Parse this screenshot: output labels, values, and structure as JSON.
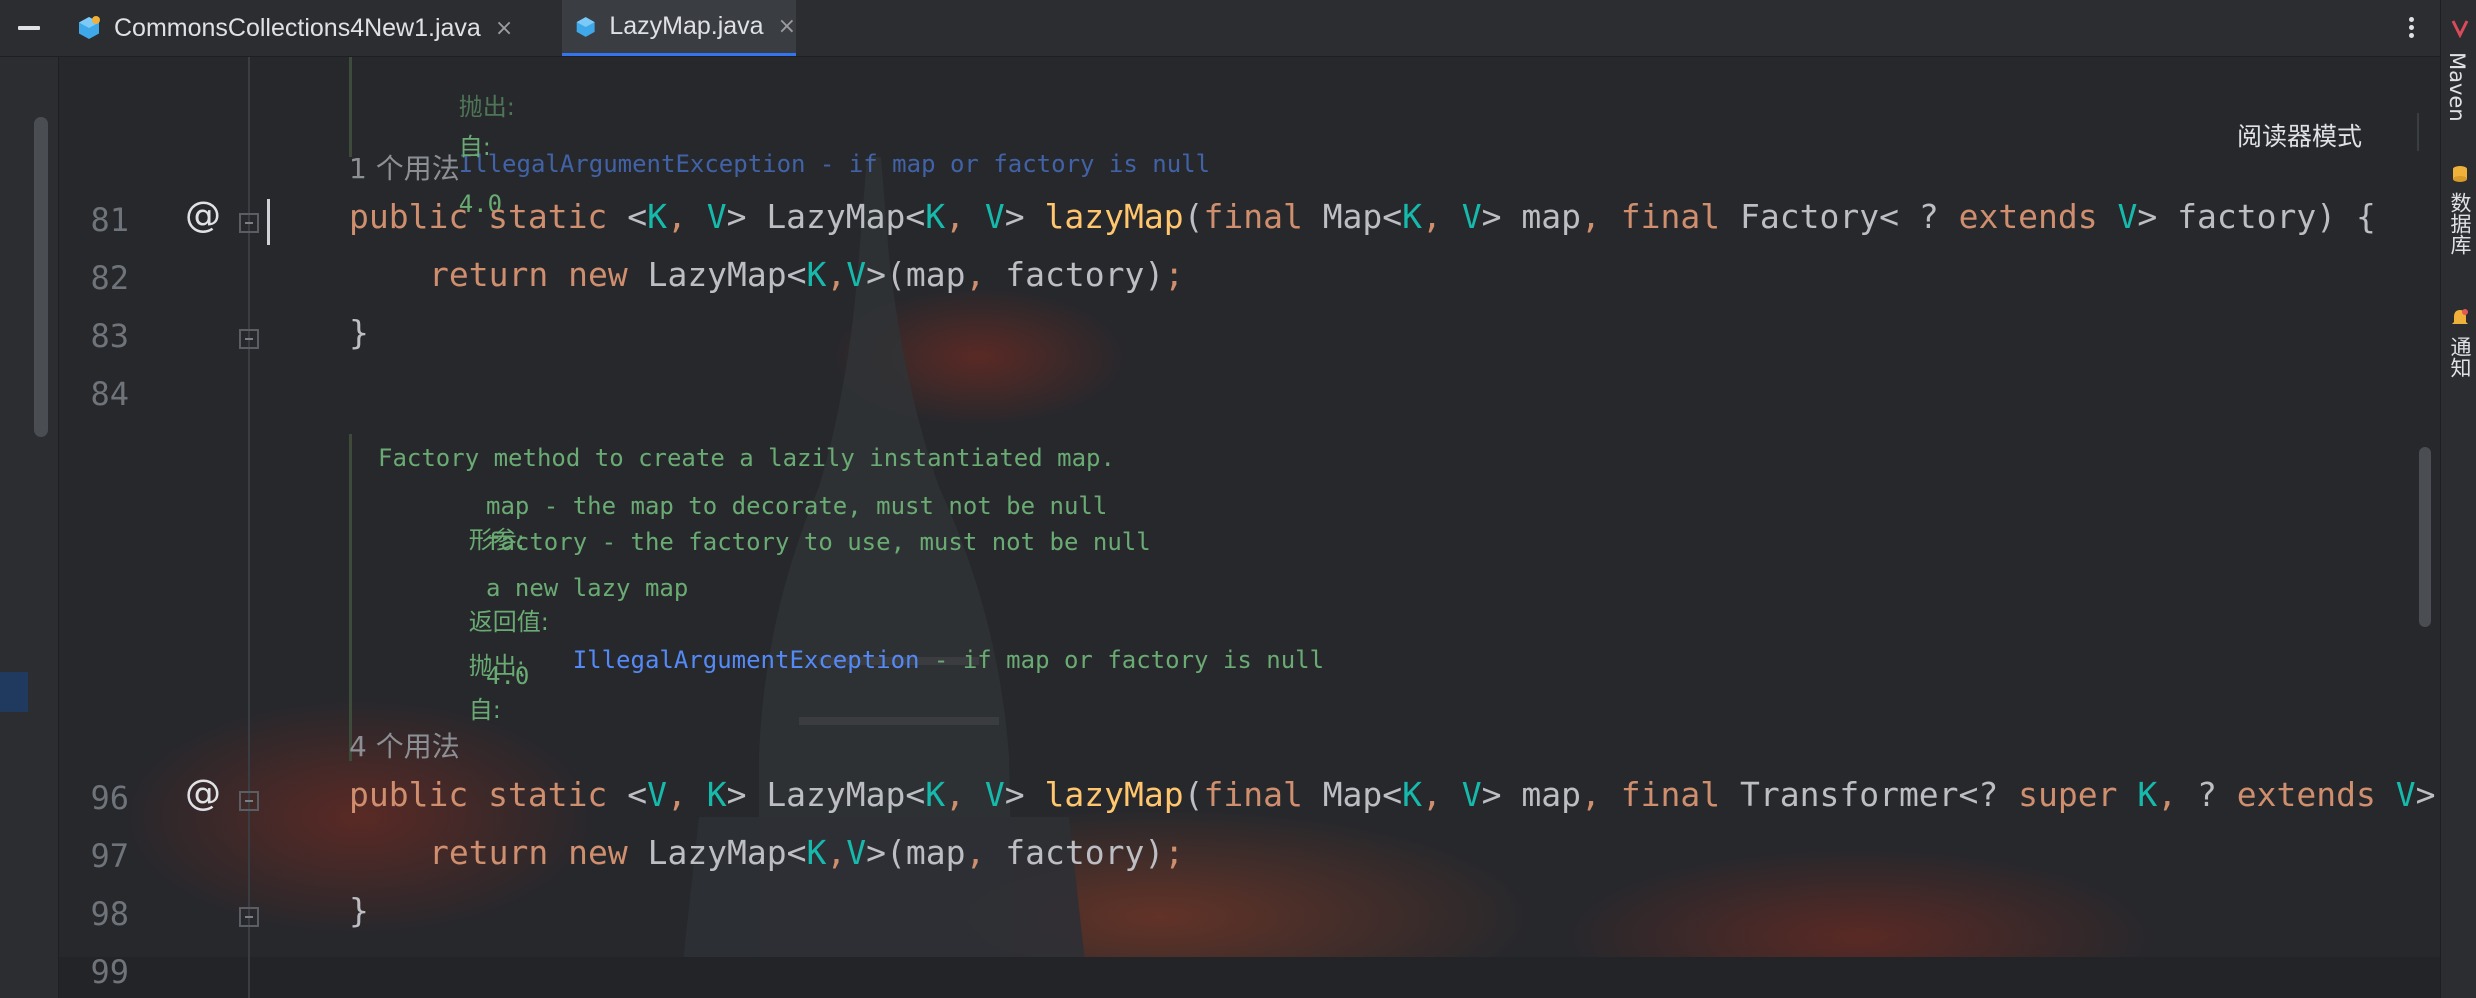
{
  "tabs": [
    {
      "label": "CommonsCollections4New1.java",
      "close": "×",
      "active": false
    },
    {
      "label": "LazyMap.java",
      "close": "×",
      "active": true
    }
  ],
  "reader_mode": "阅读器模式",
  "right_tools": [
    {
      "label": "Maven",
      "icon": "maven-icon"
    },
    {
      "label": "数据库",
      "icon": "database-icon"
    },
    {
      "label": "通知",
      "icon": "bell-icon"
    }
  ],
  "doc_top": {
    "throws_tag": "抛出:",
    "throws_text": "IllegalArgumentException - if map or factory is null",
    "since_tag": "自:",
    "since_value": "4.0"
  },
  "usage1": "1 个用法",
  "lines": [
    {
      "num": "81"
    },
    {
      "num": "82"
    },
    {
      "num": "83"
    },
    {
      "num": "84"
    },
    {
      "num": "96"
    },
    {
      "num": "97"
    },
    {
      "num": "98"
    },
    {
      "num": "99"
    }
  ],
  "at_symbol": "@",
  "code": {
    "l81": {
      "k1": "public",
      "k2": "static",
      "p1": "<",
      "t1": "K",
      "c1": ",",
      "t2": "V",
      "p2": ">",
      "ret": "LazyMap",
      "p3": "<",
      "t3": "K",
      "c2": ",",
      "t4": "V",
      "p4": ">",
      "fn": "lazyMap",
      "p5": "(",
      "k3": "final",
      "ty1": "Map",
      "p6": "<",
      "t5": "K",
      "c3": ",",
      "t6": "V",
      "p7": ">",
      "a1": "map",
      "c4": ",",
      "k4": "final",
      "ty2": "Factory",
      "p8": "<",
      "q": "?",
      "k5": "extends",
      "t7": "V",
      "p9": ">",
      "a2": "factory",
      "p10": ")",
      "brace": "{"
    },
    "l82": {
      "k1": "return",
      "k2": "new",
      "ty": "LazyMap",
      "p1": "<",
      "t1": "K",
      "c1": ",",
      "t2": "V",
      "p2": ">",
      "args": "(map",
      "c2": ",",
      "a2": "factory)",
      "semi": ";"
    },
    "l83": "}",
    "l96": {
      "k1": "public",
      "k2": "static",
      "p1": "<",
      "t1": "V",
      "c1": ",",
      "t2": "K",
      "p2": ">",
      "ret": "LazyMap",
      "p3": "<",
      "t3": "K",
      "c2": ",",
      "t4": "V",
      "p4": ">",
      "fn": "lazyMap",
      "p5": "(",
      "k3": "final",
      "ty1": "Map",
      "p6": "<",
      "t5": "K",
      "c3": ",",
      "t6": "V",
      "p7": ">",
      "a1": "map",
      "c4": ",",
      "k4": "final",
      "ty2": "Transformer",
      "p8": "<?",
      "k5": "super",
      "t7": "K",
      "c5": ",",
      "q": "?",
      "k6": "extends",
      "t8": "V",
      "p9": ">"
    },
    "l97": {
      "k1": "return",
      "k2": "new",
      "ty": "LazyMap",
      "p1": "<",
      "t1": "K",
      "c1": ",",
      "t2": "V",
      "p2": ">",
      "args": "(map",
      "c2": ",",
      "a2": "factory)",
      "semi": ";"
    },
    "l98": "}"
  },
  "doc_main": {
    "summary": "Factory method to create a lazily instantiated map.",
    "params_tag": "形参:",
    "param1": "map - the map to decorate, must not be null",
    "param2": "factory - the factory to use, must not be null",
    "returns_tag": "返回值:",
    "returns_text": "a new lazy map",
    "throws_tag": "抛出:",
    "throws_link": "IllegalArgumentException",
    "throws_text": " - if map or factory is null",
    "since_tag": "自:",
    "since_value": "4.0"
  },
  "usage4": "4 个用法",
  "colors": {
    "keyword": "#cf8e6d",
    "type_param": "#16baac",
    "method": "#ffc66d",
    "doc_text": "#6aab73",
    "doc_link": "#548af7",
    "accent": "#3574f0"
  }
}
